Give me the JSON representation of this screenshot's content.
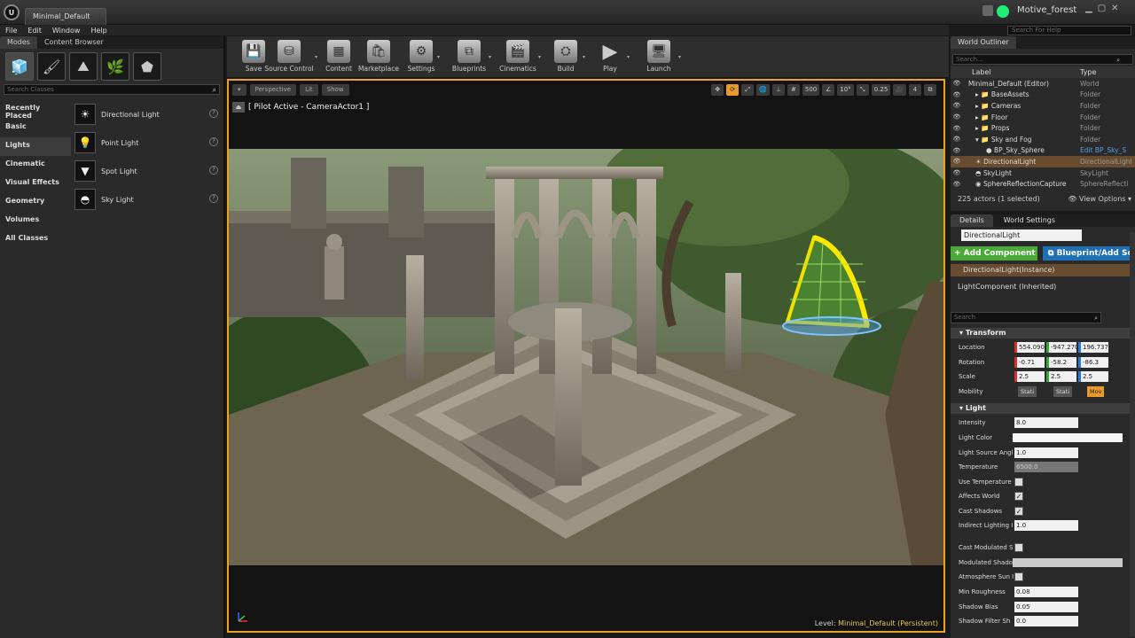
{
  "window": {
    "tab_title": "Minimal_Default",
    "project": "Motive_forest"
  },
  "menu": [
    "File",
    "Edit",
    "Window",
    "Help"
  ],
  "help_search_placeholder": "Search For Help",
  "left_panel": {
    "tabs": [
      "Modes",
      "Content Browser"
    ],
    "search_placeholder": "Search Classes",
    "categories": [
      "Recently Placed",
      "Basic",
      "Lights",
      "Cinematic",
      "Visual Effects",
      "Geometry",
      "Volumes",
      "All Classes"
    ],
    "lights": [
      "Directional Light",
      "Point Light",
      "Spot Light",
      "Sky Light"
    ]
  },
  "toolbar": {
    "buttons": [
      "Save",
      "Source Control",
      "Content",
      "Marketplace",
      "Settings",
      "Blueprints",
      "Cinematics",
      "Build",
      "Play",
      "Launch"
    ]
  },
  "viewport": {
    "mode_buttons": [
      "Perspective",
      "Lit",
      "Show"
    ],
    "grid_snap": "500",
    "rot_snap": "10°",
    "scale_snap": "0.25",
    "cam_speed": "4",
    "pilot_text": "[ Pilot Active - CameraActor1 ]",
    "level_label": "Level:",
    "level_name": "Minimal_Default (Persistent)"
  },
  "outliner": {
    "tab": "World Outliner",
    "search_placeholder": "Search...",
    "col_label": "Label",
    "col_type": "Type",
    "rows": [
      {
        "name": "Minimal_Default (Editor)",
        "type": "World"
      },
      {
        "name": "BaseAssets",
        "type": "Folder"
      },
      {
        "name": "Cameras",
        "type": "Folder"
      },
      {
        "name": "Floor",
        "type": "Folder"
      },
      {
        "name": "Props",
        "type": "Folder"
      },
      {
        "name": "Sky and Fog",
        "type": "Folder"
      },
      {
        "name": "BP_Sky_Sphere",
        "type": "Edit BP_Sky_S"
      },
      {
        "name": "DirectionalLight",
        "type": "DirectionalLight"
      },
      {
        "name": "SkyLight",
        "type": "SkyLight"
      },
      {
        "name": "SphereReflectionCapture",
        "type": "SphereReflecti"
      }
    ],
    "footer": "225 actors (1 selected)",
    "view_options": "View Options"
  },
  "details": {
    "tabs": [
      "Details",
      "World Settings"
    ],
    "actor_name": "DirectionalLight",
    "add_component": "+ Add Component",
    "blueprint_btn": "Blueprint/Add Sc",
    "instance": "DirectionalLight(Instance)",
    "inherited": "LightComponent (Inherited)",
    "search_placeholder": "Search",
    "transform": {
      "title": "Transform",
      "location_label": "Location",
      "location": [
        "554.0901",
        "-947.270",
        "196.7378"
      ],
      "rotation_label": "Rotation",
      "rotation": [
        "-0.71",
        "-58.2",
        "-86.3"
      ],
      "scale_label": "Scale",
      "scale": [
        "2.5",
        "2.5",
        "2.5"
      ],
      "mobility_label": "Mobility",
      "mobility": [
        "Stati",
        "Stati",
        "Mov"
      ]
    },
    "light": {
      "title": "Light",
      "intensity_label": "Intensity",
      "intensity": "8.0",
      "light_color_label": "Light Color",
      "source_angle_label": "Light Source Angl",
      "source_angle": "1.0",
      "temperature_label": "Temperature",
      "temperature": "6500.0",
      "use_temp_label": "Use Temperature",
      "affects_world_label": "Affects World",
      "cast_shadows_label": "Cast Shadows",
      "indirect_label": "Indirect Lighting I",
      "indirect": "1.0",
      "cast_mod_label": "Cast Modulated S",
      "mod_shadow_label": "Modulated Shado",
      "atmos_label": "Atmosphere Sun I",
      "min_rough_label": "Min Roughness",
      "min_rough": "0.08",
      "shadow_bias_label": "Shadow Bias",
      "shadow_bias": "0.05",
      "shadow_filter_label": "Shadow Filter Sh",
      "shadow_filter": "0.0"
    }
  }
}
